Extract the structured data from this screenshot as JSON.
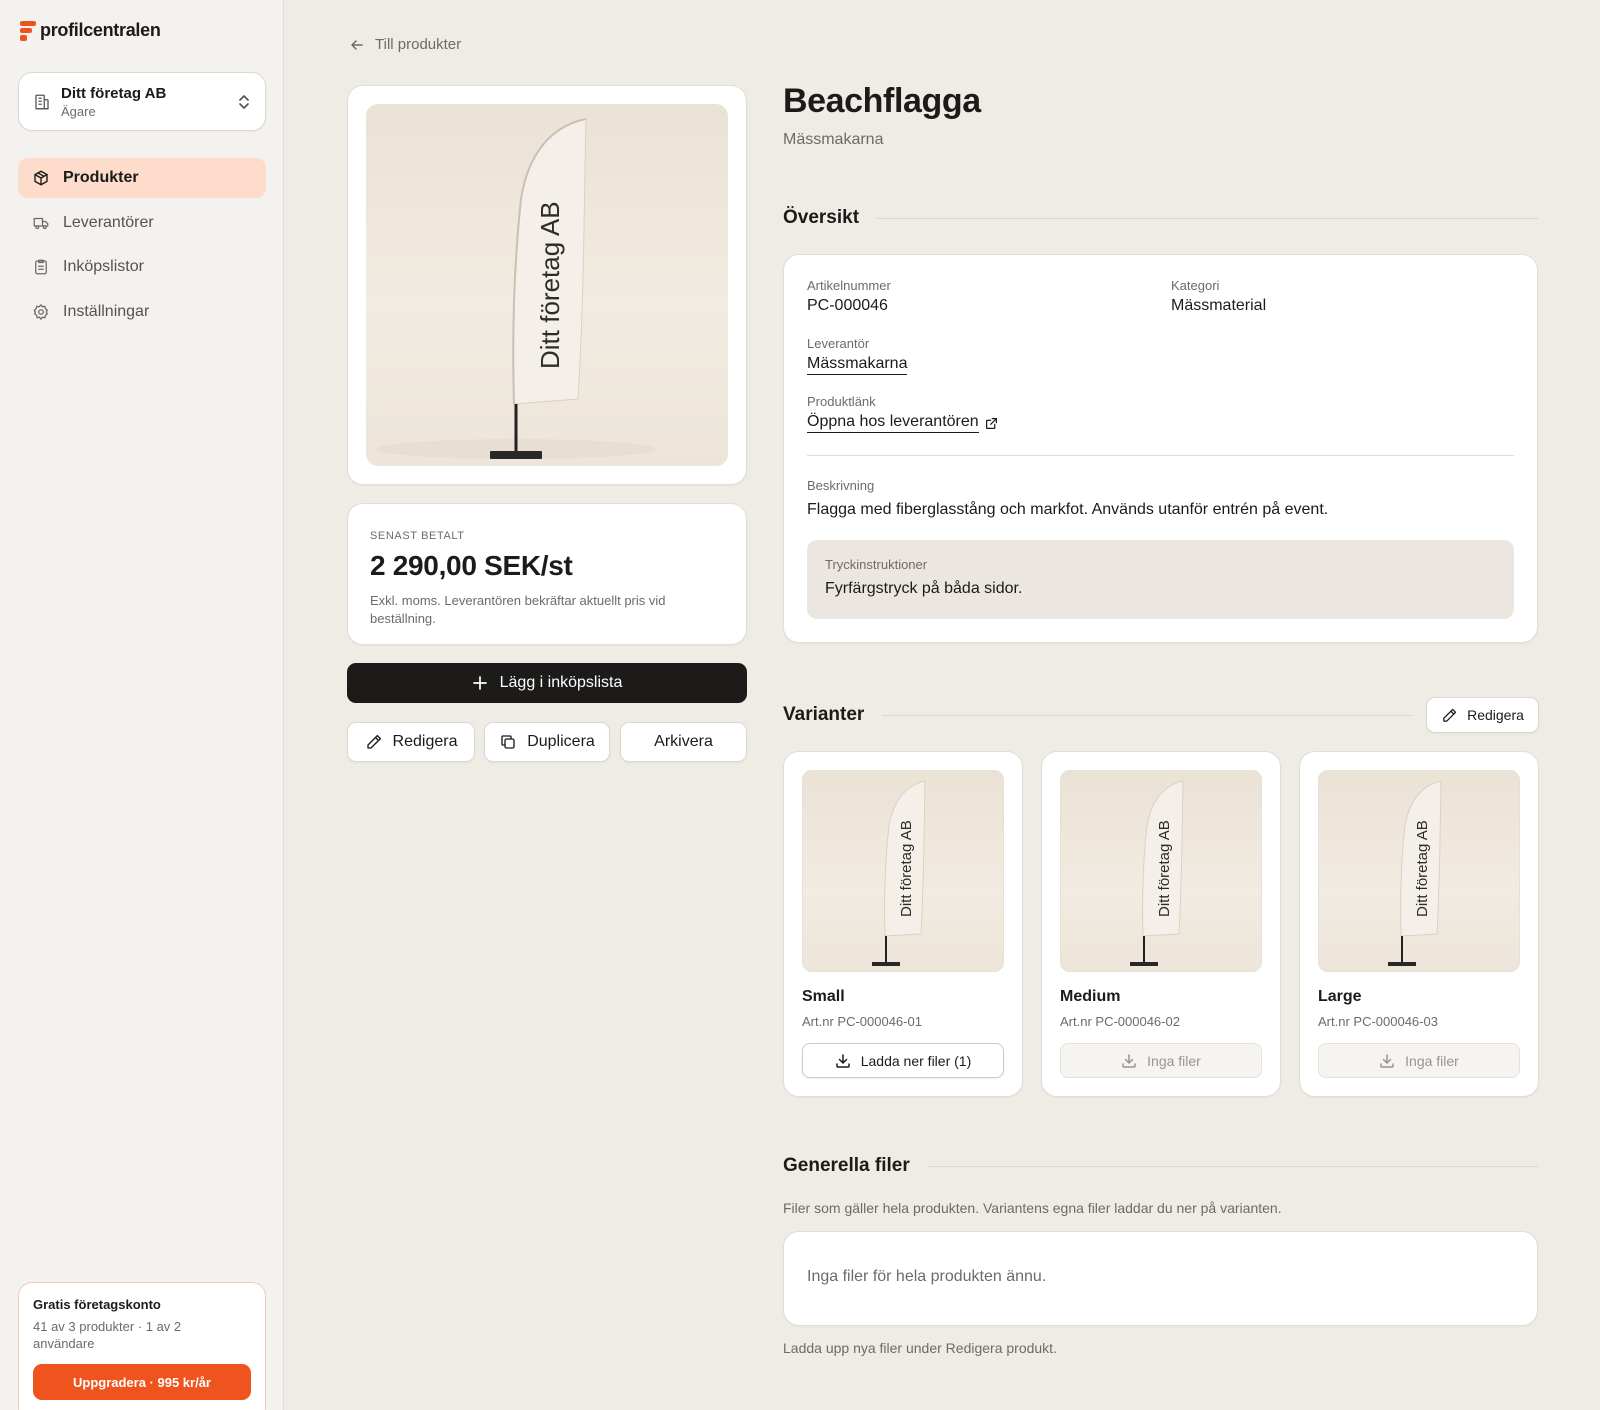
{
  "brand": {
    "name": "profilcentralen",
    "accent": "#f0541e"
  },
  "org": {
    "name": "Ditt företag AB",
    "role": "Ägare"
  },
  "nav": {
    "items": [
      {
        "label": "Produkter",
        "icon": "package-icon",
        "active": true
      },
      {
        "label": "Leverantörer",
        "icon": "truck-icon",
        "active": false
      },
      {
        "label": "Inköpslistor",
        "icon": "clipboard-icon",
        "active": false
      },
      {
        "label": "Inställningar",
        "icon": "gear-icon",
        "active": false
      }
    ]
  },
  "plan": {
    "title": "Gratis företagskonto",
    "usage": "41 av 3 produkter · 1 av 2 användare",
    "upgrade_label": "Uppgradera · 995 kr/år"
  },
  "back": {
    "label": "Till produkter"
  },
  "product": {
    "image_text": "Ditt företag AB",
    "title": "Beachflagga",
    "supplier": "Mässmakarna"
  },
  "price": {
    "label": "SENAST BETALT",
    "value": "2 290,00 SEK/st",
    "note": "Exkl. moms. Leverantören bekräftar aktuellt pris vid beställning."
  },
  "actions": {
    "add_to_list": "Lägg i inköpslista",
    "edit": "Redigera",
    "duplicate": "Duplicera",
    "archive": "Arkivera"
  },
  "overview": {
    "heading": "Översikt",
    "article_label": "Artikelnummer",
    "article_value": "PC-000046",
    "category_label": "Kategori",
    "category_value": "Mässmaterial",
    "supplier_label": "Leverantör",
    "supplier_value": "Mässmakarna",
    "link_label": "Produktlänk",
    "link_value": "Öppna hos leverantören",
    "description_label": "Beskrivning",
    "description_value": "Flagga med fiberglasstång och markfot. Används utanför entrén på event.",
    "print_label": "Tryckinstruktioner",
    "print_value": "Fyrfärgstryck på båda sidor."
  },
  "variants": {
    "heading": "Varianter",
    "edit_label": "Redigera",
    "items": [
      {
        "name": "Small",
        "art": "Art.nr PC-000046-01",
        "button": "Ladda ner filer (1)",
        "enabled": true
      },
      {
        "name": "Medium",
        "art": "Art.nr PC-000046-02",
        "button": "Inga filer",
        "enabled": false
      },
      {
        "name": "Large",
        "art": "Art.nr PC-000046-03",
        "button": "Inga filer",
        "enabled": false
      }
    ]
  },
  "general_files": {
    "heading": "Generella filer",
    "description": "Filer som gäller hela produkten. Variantens egna filer laddar du ner på varianten.",
    "empty": "Inga filer för hela produkten ännu.",
    "footer": "Ladda upp nya filer under Redigera produkt."
  }
}
